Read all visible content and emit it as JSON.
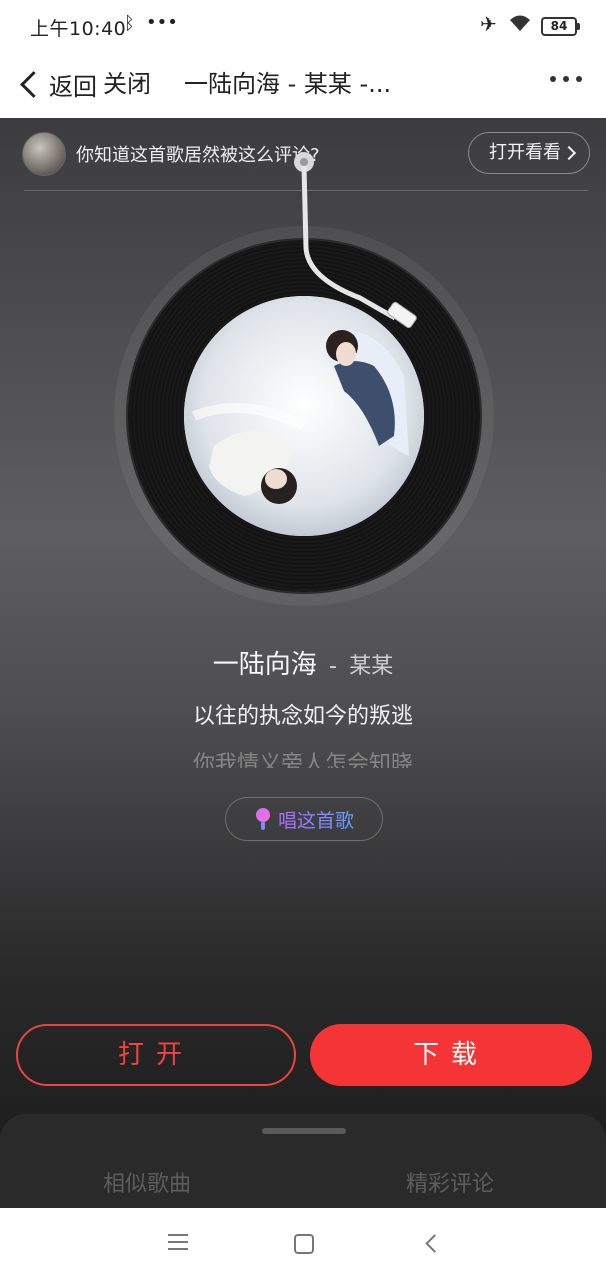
{
  "status": {
    "time": "上午10:40",
    "dots": "•••",
    "battery": "84"
  },
  "header": {
    "back_label": "返回",
    "close_label": "关闭",
    "title": "一陆向海 - 某某 -..."
  },
  "banner": {
    "text": "你知道这首歌居然被这么评论?",
    "open_look_label": "打开看看"
  },
  "song": {
    "name": "一陆向海",
    "separator": "-",
    "artist": "某某"
  },
  "lyrics": {
    "current": "以往的执念如今的叛逃",
    "next": "你我情义旁人怎会知晓"
  },
  "sing_button": {
    "label": "唱这首歌"
  },
  "actions": {
    "open_label": "打开",
    "download_label": "下载"
  },
  "sheet": {
    "tabs": [
      {
        "label": "相似歌曲"
      },
      {
        "label": "精彩评论"
      }
    ]
  },
  "colors": {
    "accent": "#f53535",
    "sing_gradient_start": "#b06bff",
    "sing_gradient_end": "#5fa0ff"
  },
  "icons": [
    "bluetooth-icon",
    "airplane-icon",
    "wifi-icon",
    "battery-icon",
    "back-chevron-icon",
    "more-icon",
    "chevron-right-icon",
    "mic-icon",
    "menu-icon",
    "home-icon",
    "nav-back-icon"
  ]
}
